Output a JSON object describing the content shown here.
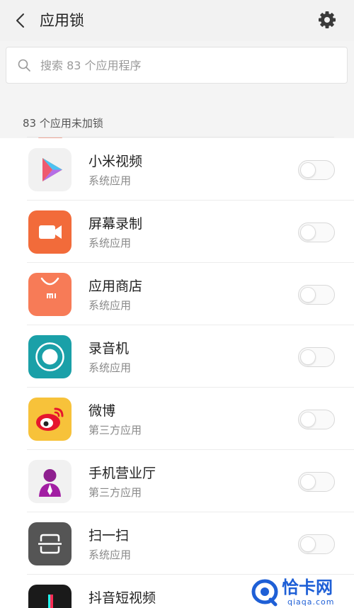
{
  "header": {
    "title": "应用锁",
    "back_icon": "chevron-left-icon",
    "settings_icon": "gear-icon"
  },
  "search": {
    "placeholder": "搜索 83 个应用程序",
    "icon": "search-icon"
  },
  "section": {
    "label": "83 个应用未加锁"
  },
  "apps": [
    {
      "name": "小米视频",
      "category": "系统应用",
      "icon": "mi-video-icon",
      "locked": false
    },
    {
      "name": "屏幕录制",
      "category": "系统应用",
      "icon": "screen-recorder-icon",
      "locked": false
    },
    {
      "name": "应用商店",
      "category": "系统应用",
      "icon": "app-store-icon",
      "locked": false
    },
    {
      "name": "录音机",
      "category": "系统应用",
      "icon": "sound-recorder-icon",
      "locked": false
    },
    {
      "name": "微博",
      "category": "第三方应用",
      "icon": "weibo-icon",
      "locked": false
    },
    {
      "name": "手机营业厅",
      "category": "第三方应用",
      "icon": "mobile-hall-icon",
      "locked": false
    },
    {
      "name": "扫一扫",
      "category": "系统应用",
      "icon": "scanner-icon",
      "locked": false
    },
    {
      "name": "抖音短视频",
      "category": "",
      "icon": "douyin-icon",
      "locked": false
    }
  ],
  "watermark": {
    "text": "恰卡网",
    "url": "qiaqa.com"
  },
  "colors": {
    "accent": "#1e5fd6",
    "screen_recorder": "#f26b3a",
    "app_store": "#f77b57",
    "sound_recorder": "#1aa0a8",
    "weibo": "#f7c23a",
    "scanner": "#555555"
  }
}
